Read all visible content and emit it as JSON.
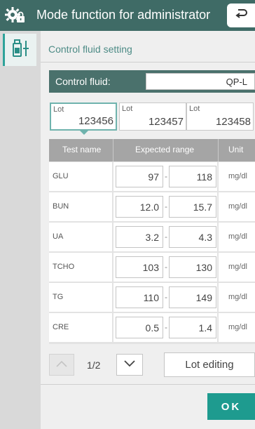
{
  "header": {
    "title": "Mode function for administrator"
  },
  "section": {
    "title": "Control fluid setting"
  },
  "control_fluid": {
    "label": "Control fluid:",
    "value": "QP-L"
  },
  "lots": [
    {
      "label": "Lot",
      "number": "123456",
      "selected": true
    },
    {
      "label": "Lot",
      "number": "123457",
      "selected": false
    },
    {
      "label": "Lot",
      "number": "123458",
      "selected": false
    }
  ],
  "table": {
    "headers": [
      "Test name",
      "Expected range",
      "Unit"
    ],
    "rows": [
      {
        "name": "GLU",
        "low": "97",
        "high": "118",
        "unit": "mg/dl"
      },
      {
        "name": "BUN",
        "low": "12.0",
        "high": "15.7",
        "unit": "mg/dl"
      },
      {
        "name": "UA",
        "low": "3.2",
        "high": "4.3",
        "unit": "mg/dl"
      },
      {
        "name": "TCHO",
        "low": "103",
        "high": "130",
        "unit": "mg/dl"
      },
      {
        "name": "TG",
        "low": "110",
        "high": "149",
        "unit": "mg/dl"
      },
      {
        "name": "CRE",
        "low": "0.5",
        "high": "1.4",
        "unit": "mg/dl"
      }
    ],
    "range_separator": "-"
  },
  "pager": {
    "label": "1/2"
  },
  "buttons": {
    "lot_editing": "Lot editing",
    "ok": "OK"
  },
  "colors": {
    "header": "#3f6b66",
    "accent": "#1e9b8f",
    "table_header": "#a5a5a5"
  }
}
